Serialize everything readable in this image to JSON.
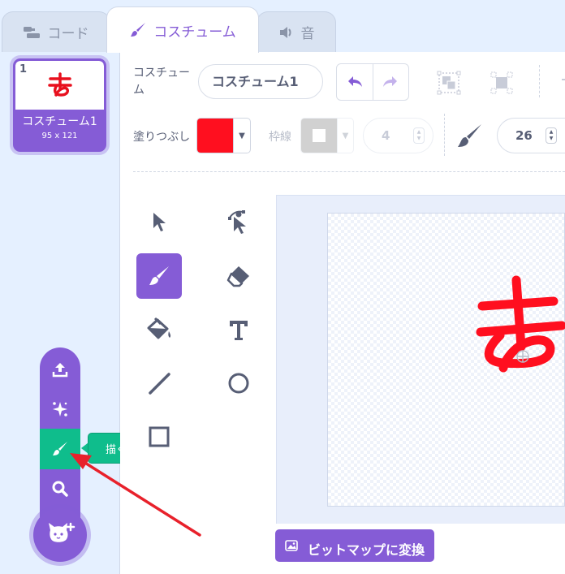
{
  "tabs": [
    {
      "label": "コード",
      "icon": "code-blocks-icon"
    },
    {
      "label": "コスチューム",
      "icon": "paintbrush-icon"
    },
    {
      "label": "音",
      "icon": "speaker-icon"
    }
  ],
  "costume_list": {
    "items": [
      {
        "number": "1",
        "name": "コスチューム1",
        "size": "95 x 121"
      }
    ]
  },
  "toolbar": {
    "costume_label": "コスチューム",
    "costume_name": "コスチューム1",
    "fill_label": "塗りつぶし",
    "fill_color": "#ff0f1f",
    "outline_label": "枠線",
    "outline_width": "4",
    "brush_size": "26"
  },
  "tools": [
    {
      "name": "select",
      "icon": "select-arrow-icon"
    },
    {
      "name": "reshape",
      "icon": "reshape-icon"
    },
    {
      "name": "brush",
      "icon": "brush-icon",
      "selected": true
    },
    {
      "name": "eraser",
      "icon": "eraser-icon"
    },
    {
      "name": "fill",
      "icon": "fill-bucket-icon"
    },
    {
      "name": "text",
      "icon": "text-icon"
    },
    {
      "name": "line",
      "icon": "line-icon"
    },
    {
      "name": "circle",
      "icon": "circle-icon"
    },
    {
      "name": "rectangle",
      "icon": "rectangle-icon"
    }
  ],
  "costume_menu": {
    "items": [
      "upload-icon",
      "surprise-sparkle-icon",
      "paint-brush-icon",
      "search-icon"
    ],
    "tooltip": "描く",
    "highlight_color": "#0fbd8c"
  },
  "canvas": {
    "convert_button": "ビットマップに変換"
  },
  "colors": {
    "accent": "#855cd6",
    "background": "#e5f0ff",
    "annotation_arrow": "#e8212b"
  }
}
